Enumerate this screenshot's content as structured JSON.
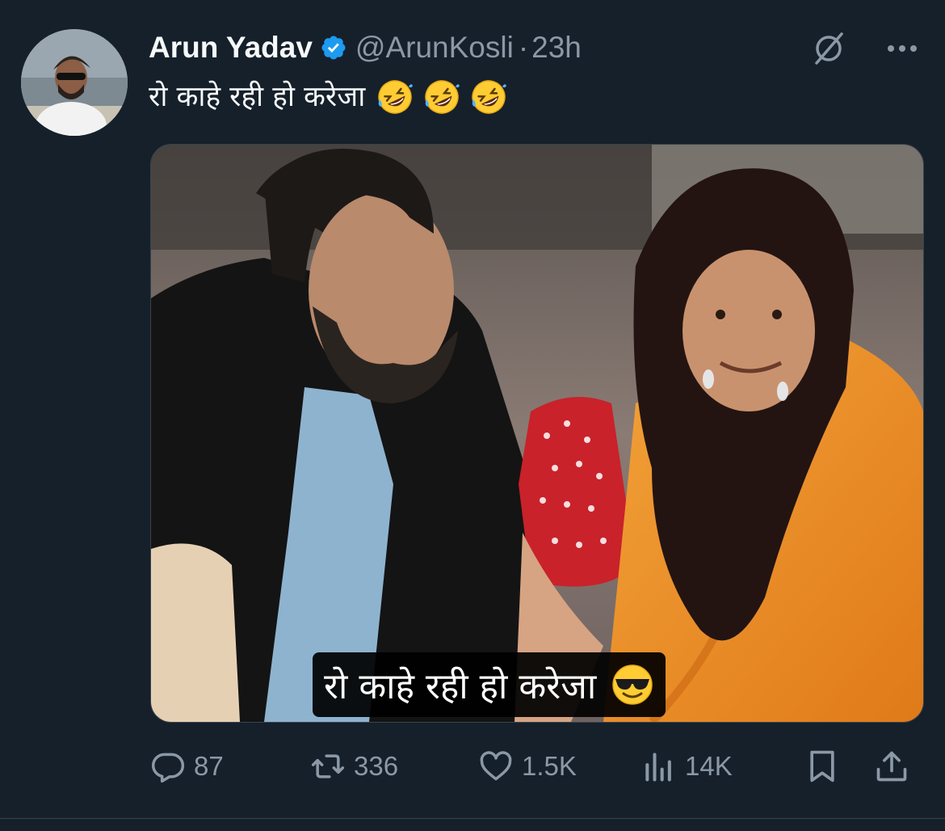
{
  "author": {
    "name": "Arun Yadav",
    "handle": "@ArunKosli",
    "separator": "·",
    "time": "23h",
    "verified": true,
    "badge_color": "#1d9bf0"
  },
  "icons": {
    "top_right": [
      "grok-icon",
      "more-icon"
    ],
    "actions": [
      "reply-icon",
      "retweet-icon",
      "like-icon",
      "views-icon",
      "bookmark-icon",
      "share-icon"
    ]
  },
  "tweet": {
    "text": "रो काहे रही हो करेजा",
    "emojis": [
      "rolling-on-floor-laughing",
      "rolling-on-floor-laughing",
      "rolling-on-floor-laughing"
    ]
  },
  "media": {
    "caption_text": "रो काहे रही हो करेजा",
    "caption_emoji": "smiling-face-with-sunglasses"
  },
  "stats": {
    "replies": "87",
    "retweets": "336",
    "likes": "1.5K",
    "views": "14K"
  },
  "colors": {
    "background": "#15202b",
    "text_primary": "#f7f9f9",
    "text_secondary": "#8b98a5"
  }
}
